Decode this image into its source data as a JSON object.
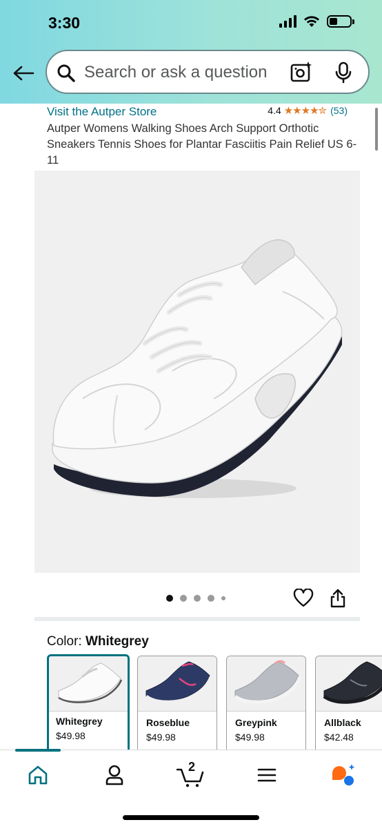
{
  "status_bar": {
    "time": "3:30"
  },
  "search": {
    "placeholder": "Search or ask a question"
  },
  "product": {
    "store_link": "Visit the Autper Store",
    "rating_value": "4.4",
    "rating_stars": "★★★★✮",
    "review_count": "(53)",
    "title": "Autper Womens Walking Shoes Arch Support Orthotic Sneakers Tennis Shoes for Plantar Fasciitis Pain Relief US 6-11"
  },
  "gallery": {
    "image_count": 5,
    "active_index": 0
  },
  "color": {
    "label": "Color:",
    "selected": "Whitegrey",
    "options": [
      {
        "name": "Whitegrey",
        "price": "$49.98"
      },
      {
        "name": "Roseblue",
        "price": "$49.98"
      },
      {
        "name": "Greypink",
        "price": "$49.98"
      },
      {
        "name": "Allblack",
        "price": "$42.48"
      }
    ]
  },
  "bottom_nav": {
    "items": [
      "home-icon",
      "account-icon",
      "cart-icon",
      "menu-icon",
      "rufus-icon"
    ],
    "cart_count": "2"
  },
  "colors": {
    "accent_teal": "#00717f",
    "link": "#007185",
    "star": "#de7921"
  }
}
